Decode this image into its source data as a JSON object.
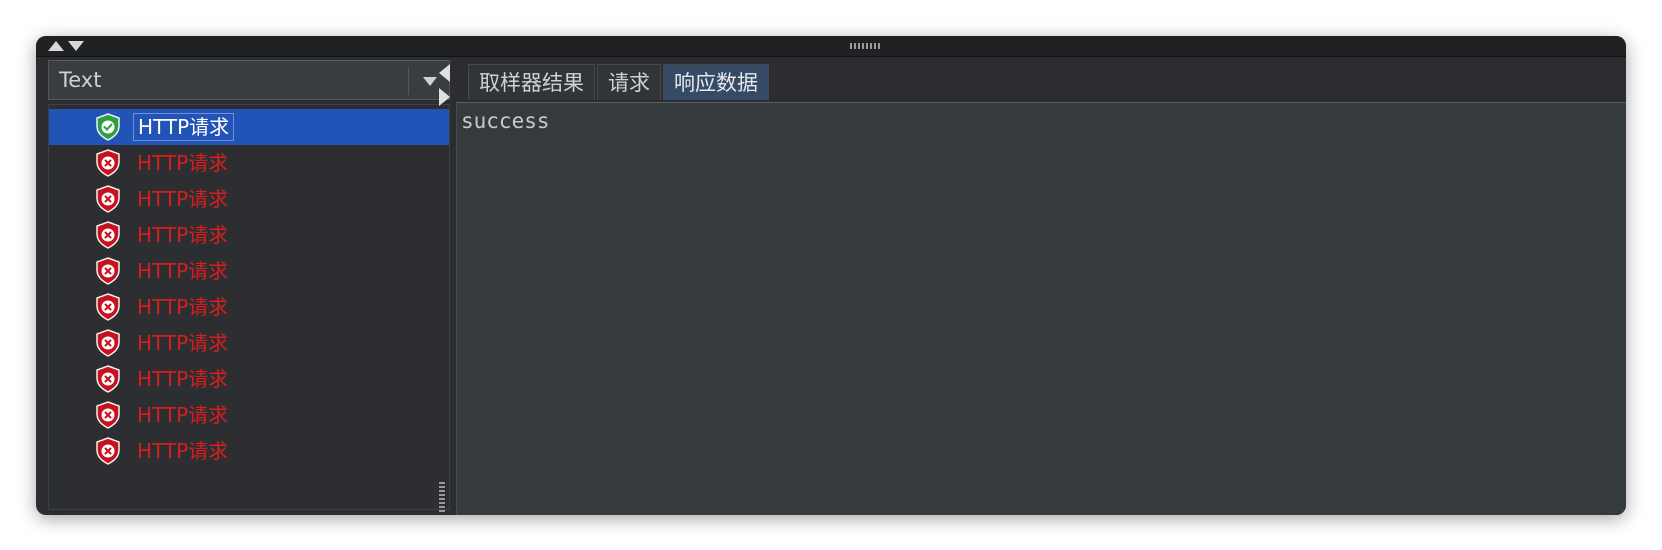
{
  "filter": {
    "selected": "Text"
  },
  "results": [
    {
      "label": "HTTP请求",
      "status": "success"
    },
    {
      "label": "HTTP请求",
      "status": "error"
    },
    {
      "label": "HTTP请求",
      "status": "error"
    },
    {
      "label": "HTTP请求",
      "status": "error"
    },
    {
      "label": "HTTP请求",
      "status": "error"
    },
    {
      "label": "HTTP请求",
      "status": "error"
    },
    {
      "label": "HTTP请求",
      "status": "error"
    },
    {
      "label": "HTTP请求",
      "status": "error"
    },
    {
      "label": "HTTP请求",
      "status": "error"
    },
    {
      "label": "HTTP请求",
      "status": "error"
    }
  ],
  "tabs": [
    {
      "label": "取样器结果"
    },
    {
      "label": "请求"
    },
    {
      "label": "响应数据"
    }
  ],
  "active_tab": "响应数据",
  "response": {
    "body": "success"
  },
  "colors": {
    "success_icon": "#2ea043",
    "error_icon": "#c8101e",
    "error_text": "#d71e1e",
    "selection": "#2254b8"
  }
}
